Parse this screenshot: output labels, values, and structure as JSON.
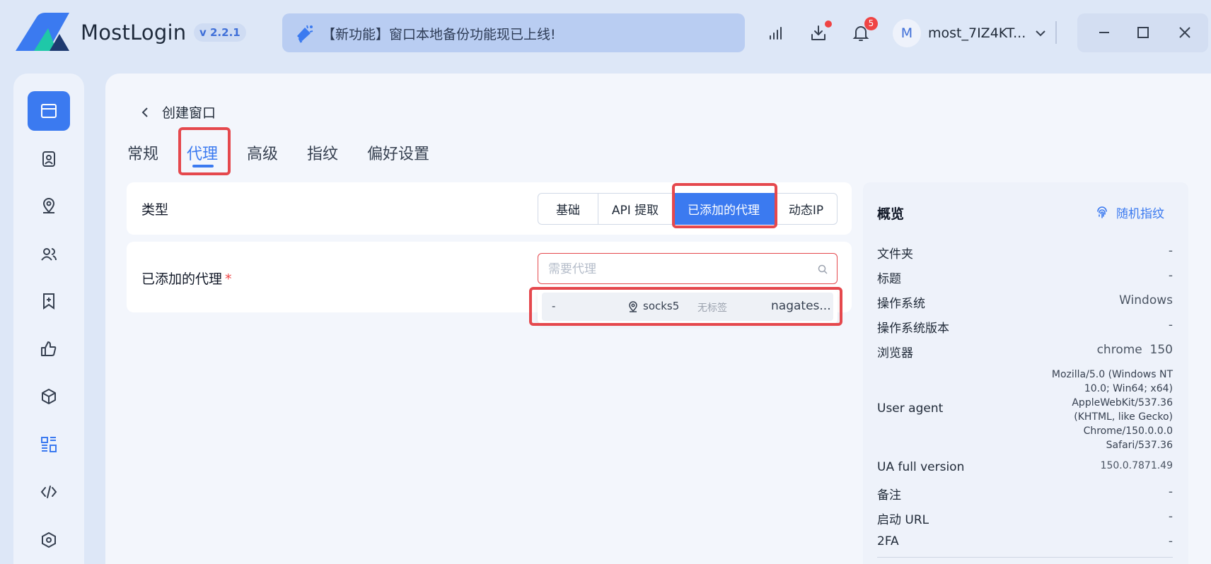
{
  "app": {
    "name": "MostLogin",
    "version": "v 2.2.1",
    "announcement": "【新功能】窗口本地备份功能现已上线!",
    "notification_count": "5",
    "avatar_initial": "M",
    "username": "most_7IZ4KT..."
  },
  "sidebar": {
    "items": [
      {
        "icon": "browser-window-icon",
        "active": true
      },
      {
        "icon": "profile-card-icon"
      },
      {
        "icon": "location-pin-icon"
      },
      {
        "icon": "users-icon"
      },
      {
        "icon": "bookmark-add-icon"
      },
      {
        "icon": "thumbs-up-icon"
      },
      {
        "icon": "cube-icon"
      },
      {
        "icon": "layout-grid-icon"
      },
      {
        "icon": "code-icon"
      },
      {
        "icon": "settings-hex-icon"
      }
    ]
  },
  "page": {
    "title": "创建窗口",
    "tabs": [
      "常规",
      "代理",
      "高级",
      "指纹",
      "偏好设置"
    ],
    "active_tab": "代理"
  },
  "proxy": {
    "type_label": "类型",
    "type_options": [
      "基础",
      "API 提取",
      "已添加的代理",
      "动态IP"
    ],
    "active_type": "已添加的代理",
    "added_label": "已添加的代理",
    "required_mark": "*",
    "search_placeholder": "需要代理",
    "dropdown_item": {
      "name": "-",
      "protocol": "socks5",
      "tag": "无标签",
      "host": "nagates..."
    }
  },
  "overview": {
    "title": "概览",
    "random_label": "随机指纹",
    "rows": [
      {
        "key": "文件夹",
        "value": "-"
      },
      {
        "key": "标题",
        "value": "-"
      },
      {
        "key": "操作系统",
        "value": "Windows"
      },
      {
        "key": "操作系统版本",
        "value": "-"
      },
      {
        "key": "浏览器",
        "value": "chrome  150"
      },
      {
        "key": "User agent",
        "value_lines": [
          "Mozilla/5.0 (Windows NT",
          "10.0; Win64; x64)",
          "AppleWebKit/537.36",
          "(KHTML, like Gecko)",
          "Chrome/150.0.0.0",
          "Safari/537.36"
        ]
      },
      {
        "key": "UA full version",
        "value": "150.0.7871.49"
      },
      {
        "key": "备注",
        "value": "-"
      },
      {
        "key": "启动 URL",
        "value": "-"
      },
      {
        "key": "2FA",
        "value": "-"
      }
    ]
  },
  "colors": {
    "accent": "#3b7af0",
    "highlight": "#e5484d",
    "background": "#dde7f7"
  }
}
